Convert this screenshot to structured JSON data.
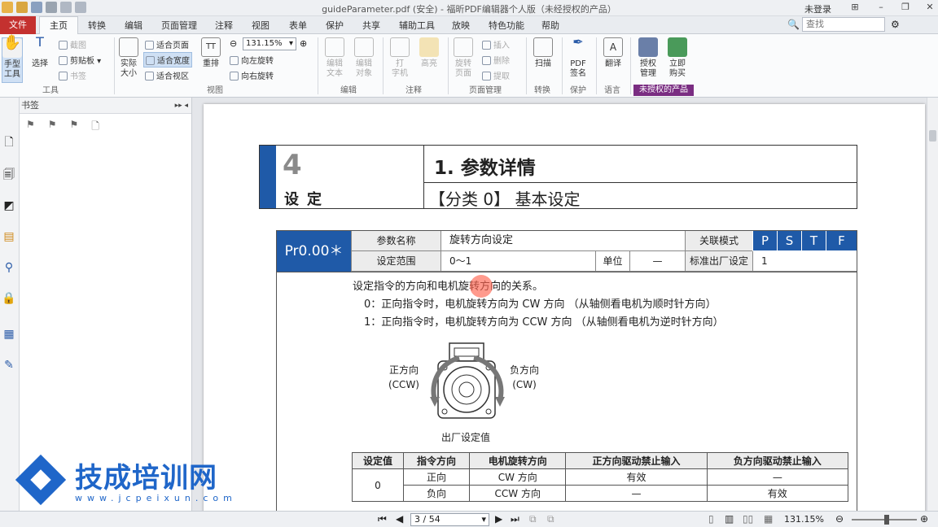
{
  "window": {
    "title": "guideParameter.pdf (安全) - 福昕PDF编辑器个人版（未经授权的产品）",
    "login": "未登录"
  },
  "tabs": {
    "file": "文件",
    "home": "主页",
    "items": [
      "转换",
      "编辑",
      "页面管理",
      "注释",
      "视图",
      "表单",
      "保护",
      "共享",
      "辅助工具",
      "放映",
      "特色功能",
      "帮助"
    ]
  },
  "search": {
    "placeholder": "查找"
  },
  "ribbon": {
    "hand": "手型\n工具",
    "select": "选择",
    "screenshot": "截图",
    "clipboard": "剪贴板",
    "bookmark": "书签",
    "group_tools": "工具",
    "actual": "实际\n大小",
    "fit_page": "适合页面",
    "fit_width": "适合宽度",
    "fit_view": "适合视区",
    "reflow": "重排",
    "zoom": "131.15%",
    "rot_left": "向左旋转",
    "rot_right": "向右旋转",
    "group_view": "视图",
    "edit_text": "编辑\n文本",
    "edit_obj": "编辑\n对象",
    "group_edit": "编辑",
    "typewriter": "打\n字机",
    "highlight": "高亮",
    "group_comment": "注释",
    "rotate_page": "旋转\n页面",
    "insert": "插入",
    "delete": "删除",
    "extract": "提取",
    "group_page": "页面管理",
    "scan": "扫描",
    "group_convert": "转换",
    "pdf_sign": "PDF\n签名",
    "group_protect": "保护",
    "translate": "翻译",
    "group_lang": "语言",
    "license": "授权\n管理",
    "buy": "立即\n购买",
    "unlicensed": "未授权的产品"
  },
  "panel": {
    "title": "书签"
  },
  "doc": {
    "chapter_num": "4",
    "chapter_word": "设定",
    "section_title": "1. 参数详情",
    "subtitle": "【分类 0】 基本设定",
    "param_code": "Pr0.00＊",
    "lbl_name": "参数名称",
    "name": "旋转方向设定",
    "lbl_mode": "关联模式",
    "modes": [
      "P",
      "S",
      "T",
      "F"
    ],
    "lbl_range": "设定范围",
    "range": "0〜1",
    "lbl_unit": "单位",
    "unit": "—",
    "lbl_default": "标准出厂设定",
    "default": "1",
    "desc": "设定指令的方向和电机旋转方向的关系。",
    "opt0": "0：正向指令时，电机旋转方向为 CW 方向 （从轴侧看电机为顺时针方向）",
    "opt1": "1：正向指令时，电机旋转方向为 CCW 方向 （从轴侧看电机为逆时针方向）",
    "fwd": "正方向",
    "ccw": "(CCW)",
    "rev": "负方向",
    "cw": "(CW)",
    "caption": "出厂设定值",
    "table": {
      "headers": [
        "设定值",
        "指令方向",
        "电机旋转方向",
        "正方向驱动禁止输入",
        "负方向驱动禁止输入"
      ],
      "rows": [
        [
          "0",
          "正向",
          "CW 方向",
          "有效",
          "—"
        ],
        [
          "",
          "负向",
          "CCW 方向",
          "—",
          "有效"
        ]
      ]
    }
  },
  "watermark": {
    "name": "技成培训网",
    "url": "www.jcpeixun.com"
  },
  "status": {
    "page": "3 / 54",
    "zoom": "131.15%"
  }
}
